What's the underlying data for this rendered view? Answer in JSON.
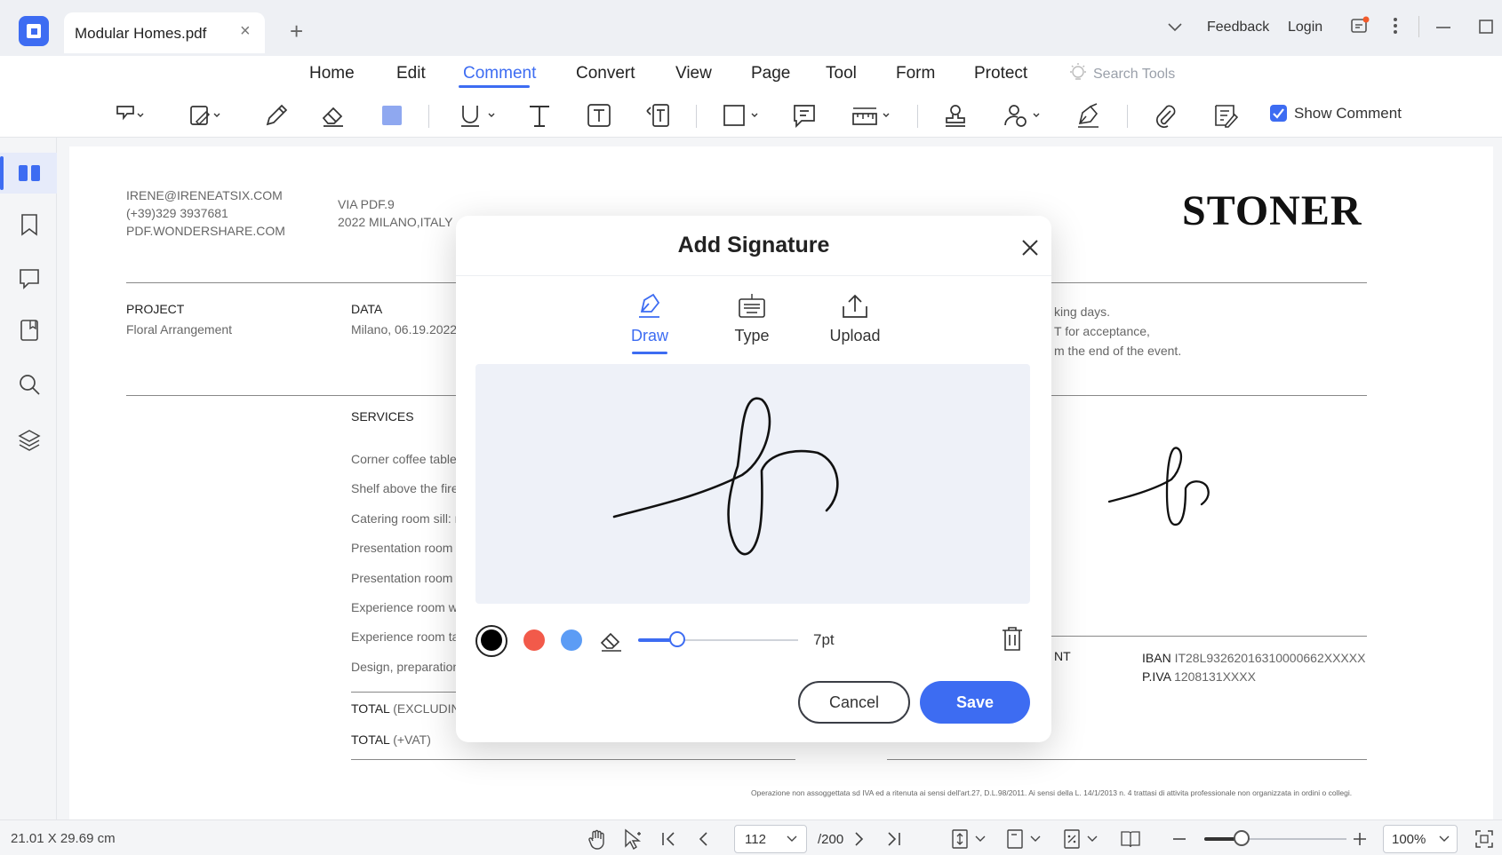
{
  "titlebar": {
    "tab_title": "Modular Homes.pdf",
    "feedback": "Feedback",
    "login": "Login"
  },
  "menu": {
    "items": [
      "Home",
      "Edit",
      "Comment",
      "Convert",
      "View",
      "Page",
      "Tool",
      "Form",
      "Protect"
    ],
    "active": "Comment",
    "search_placeholder": "Search Tools"
  },
  "toolbar": {
    "tools": [
      "highlight-icon",
      "area-highlight-icon",
      "pencil-icon",
      "eraser-icon",
      "color-fill-icon",
      "underline-icon",
      "text-icon",
      "textbox-icon",
      "callout-icon",
      "rectangle-icon",
      "note-icon",
      "measure-icon",
      "stamp-icon",
      "signature-icon",
      "sign-pen-icon",
      "attachment-icon",
      "comment-list-icon"
    ],
    "show_comment_label": "Show Comment",
    "show_comment_checked": true,
    "accent_color": "#3d6cf2"
  },
  "sidebar": {
    "items": [
      "thumbnails-icon",
      "bookmark-icon",
      "comment-icon",
      "attachment-panel-icon",
      "search-icon",
      "layers-icon"
    ]
  },
  "document": {
    "contact": [
      "IRENE@IRENEATSIX.COM",
      "(+39)329 3937681",
      "PDF.WONDERSHARE.COM"
    ],
    "address": [
      "VIA PDF.9",
      "2022 MILANO,ITALY"
    ],
    "brand": "STONER",
    "project_label": "PROJECT",
    "project_value": "Floral Arrangement",
    "data_label": "DATA",
    "data_value": "Milano, 06.19.2022",
    "terms": [
      "king days.",
      "T for acceptance,",
      "m the end of the event."
    ],
    "services_label": "SERVICES",
    "services": [
      "Corner coffee table:",
      "Shelf above the fire",
      "Catering room sill: m",
      "Presentation room s",
      "Presentation room c",
      "Experience room wi",
      "Experience room tal",
      "Design, preparation"
    ],
    "payment_label": "NT",
    "iban_label": "IBAN",
    "iban_value": "IT28L93262016310000662XXXXX",
    "piva_label": "P.IVA",
    "piva_value": "1208131XXXX",
    "total1_label": "TOTAL",
    "total1_note": "(EXCLUDING",
    "total2_label": "TOTAL",
    "total2_note": "(+VAT)",
    "footer_note": "Operazione non assoggettata sd IVA ed a ritenuta ai sensi dell'art.27, D.L.98/2011. Ai sensi della L. 14/1/2013 n. 4 trattasi di attivita professionale non organizzata in ordini o collegi."
  },
  "modal": {
    "title": "Add Signature",
    "tabs": [
      "Draw",
      "Type",
      "Upload"
    ],
    "active_tab": "Draw",
    "colors": [
      "#000000",
      "#f25a4a",
      "#5c9cf5"
    ],
    "selected_color": "#000000",
    "stroke_size_label": "7pt",
    "stroke_level": 0.24,
    "cancel_label": "Cancel",
    "save_label": "Save"
  },
  "statusbar": {
    "dimensions": "21.01 X 29.69 cm",
    "current_page": "112",
    "total_pages": "/200",
    "zoom": "100%",
    "zoom_level": 0.26
  }
}
